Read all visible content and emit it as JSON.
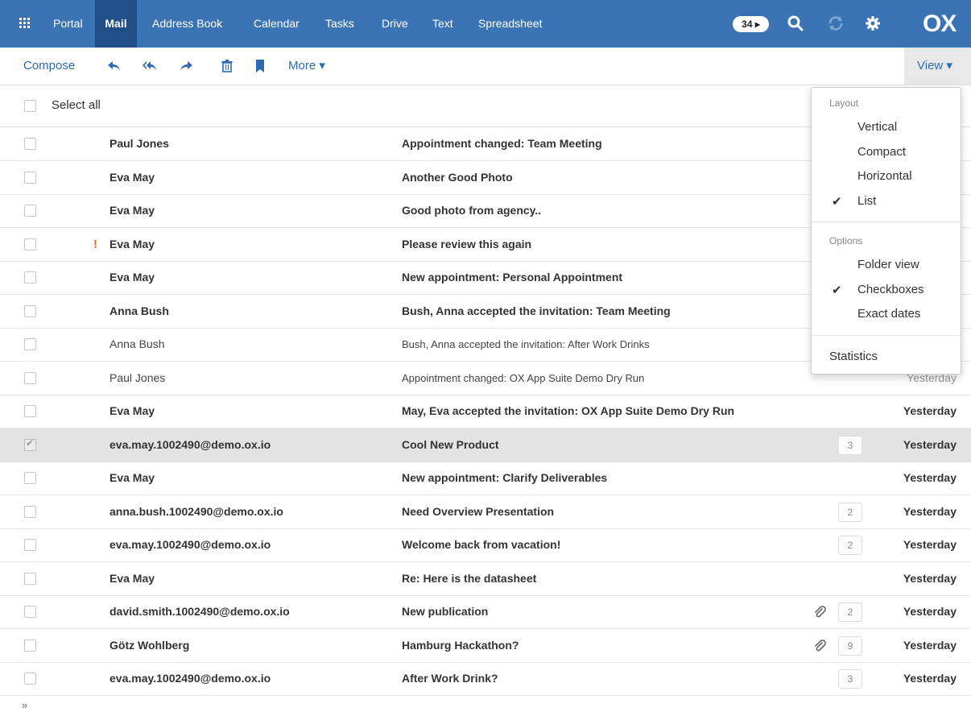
{
  "topbar": {
    "nav": [
      "Portal",
      "Mail",
      "Address Book",
      "Calendar",
      "Tasks",
      "Drive",
      "Text",
      "Spreadsheet"
    ],
    "active": "Mail",
    "badge": "34 ▸",
    "logo": "OX",
    "icons": [
      "apps-grid-icon",
      "search-icon",
      "refresh-icon",
      "settings-gear-icon"
    ]
  },
  "toolbar": {
    "compose": "Compose",
    "more": "More ▾",
    "view": "View ▾",
    "icons": [
      "reply-icon",
      "reply-all-icon",
      "forward-icon",
      "delete-icon",
      "flag-icon"
    ]
  },
  "list": {
    "select_all": "Select all",
    "rows": [
      {
        "from": "Paul Jones",
        "subject": "Appointment changed: Team Meeting",
        "date": "",
        "count": "",
        "unread": true,
        "priority": false,
        "attachment": false,
        "selected": false
      },
      {
        "from": "Eva May",
        "subject": "Another Good Photo",
        "date": "",
        "count": "",
        "unread": true,
        "priority": false,
        "attachment": false,
        "selected": false
      },
      {
        "from": "Eva May",
        "subject": "Good photo from agency..",
        "date": "",
        "count": "",
        "unread": true,
        "priority": false,
        "attachment": false,
        "selected": false
      },
      {
        "from": "Eva May",
        "subject": "Please review this again",
        "date": "",
        "count": "",
        "unread": true,
        "priority": true,
        "attachment": false,
        "selected": false
      },
      {
        "from": "Eva May",
        "subject": "New appointment: Personal Appointment",
        "date": "",
        "count": "",
        "unread": true,
        "priority": false,
        "attachment": false,
        "selected": false
      },
      {
        "from": "Anna Bush",
        "subject": "Bush, Anna accepted the invitation: Team Meeting",
        "date": "",
        "count": "",
        "unread": true,
        "priority": false,
        "attachment": false,
        "selected": false
      },
      {
        "from": "Anna Bush",
        "subject": "Bush, Anna accepted the invitation: After Work Drinks",
        "date": "",
        "count": "",
        "unread": false,
        "priority": false,
        "attachment": false,
        "selected": false
      },
      {
        "from": "Paul Jones",
        "subject": "Appointment changed: OX App Suite Demo Dry Run",
        "date": "",
        "count": "",
        "unread": false,
        "priority": false,
        "attachment": false,
        "selected": false
      },
      {
        "from": "Eva May",
        "subject": "May, Eva accepted the invitation: OX App Suite Demo Dry Run",
        "date": "Yesterday",
        "count": "",
        "unread": true,
        "priority": false,
        "attachment": false,
        "selected": false
      },
      {
        "from": "eva.may.1002490@demo.ox.io",
        "subject": "Cool New Product",
        "date": "Yesterday",
        "count": "3",
        "unread": true,
        "priority": false,
        "attachment": false,
        "selected": true
      },
      {
        "from": "Eva May",
        "subject": "New appointment: Clarify Deliverables",
        "date": "Yesterday",
        "count": "",
        "unread": true,
        "priority": false,
        "attachment": false,
        "selected": false
      },
      {
        "from": "anna.bush.1002490@demo.ox.io",
        "subject": "Need Overview Presentation",
        "date": "Yesterday",
        "count": "2",
        "unread": true,
        "priority": false,
        "attachment": false,
        "selected": false
      },
      {
        "from": "eva.may.1002490@demo.ox.io",
        "subject": "Welcome back from vacation!",
        "date": "Yesterday",
        "count": "2",
        "unread": true,
        "priority": false,
        "attachment": false,
        "selected": false
      },
      {
        "from": "Eva May",
        "subject": "Re: Here is the datasheet",
        "date": "Yesterday",
        "count": "",
        "unread": true,
        "priority": false,
        "attachment": false,
        "selected": false
      },
      {
        "from": "david.smith.1002490@demo.ox.io",
        "subject": "New publication",
        "date": "Yesterday",
        "count": "2",
        "unread": true,
        "priority": false,
        "attachment": true,
        "selected": false
      },
      {
        "from": "Götz Wohlberg",
        "subject": "Hamburg Hackathon?",
        "date": "Yesterday",
        "count": "9",
        "unread": true,
        "priority": false,
        "attachment": true,
        "selected": false
      },
      {
        "from": "eva.may.1002490@demo.ox.io",
        "subject": "After Work Drink?",
        "date": "Yesterday",
        "count": "3",
        "unread": true,
        "priority": false,
        "attachment": false,
        "selected": false
      }
    ],
    "more_pages": "»"
  },
  "view_menu": {
    "layout_header": "Layout",
    "layout_items": [
      {
        "label": "Vertical",
        "checked": false
      },
      {
        "label": "Compact",
        "checked": false
      },
      {
        "label": "Horizontal",
        "checked": false
      },
      {
        "label": "List",
        "checked": true
      }
    ],
    "options_header": "Options",
    "option_items": [
      {
        "label": "Folder view",
        "checked": false
      },
      {
        "label": "Checkboxes",
        "checked": true
      },
      {
        "label": "Exact dates",
        "checked": false
      }
    ],
    "statistics": "Statistics",
    "check_glyph": "✔",
    "priority_glyph": "!",
    "partial_date_text": "Yesterday"
  }
}
